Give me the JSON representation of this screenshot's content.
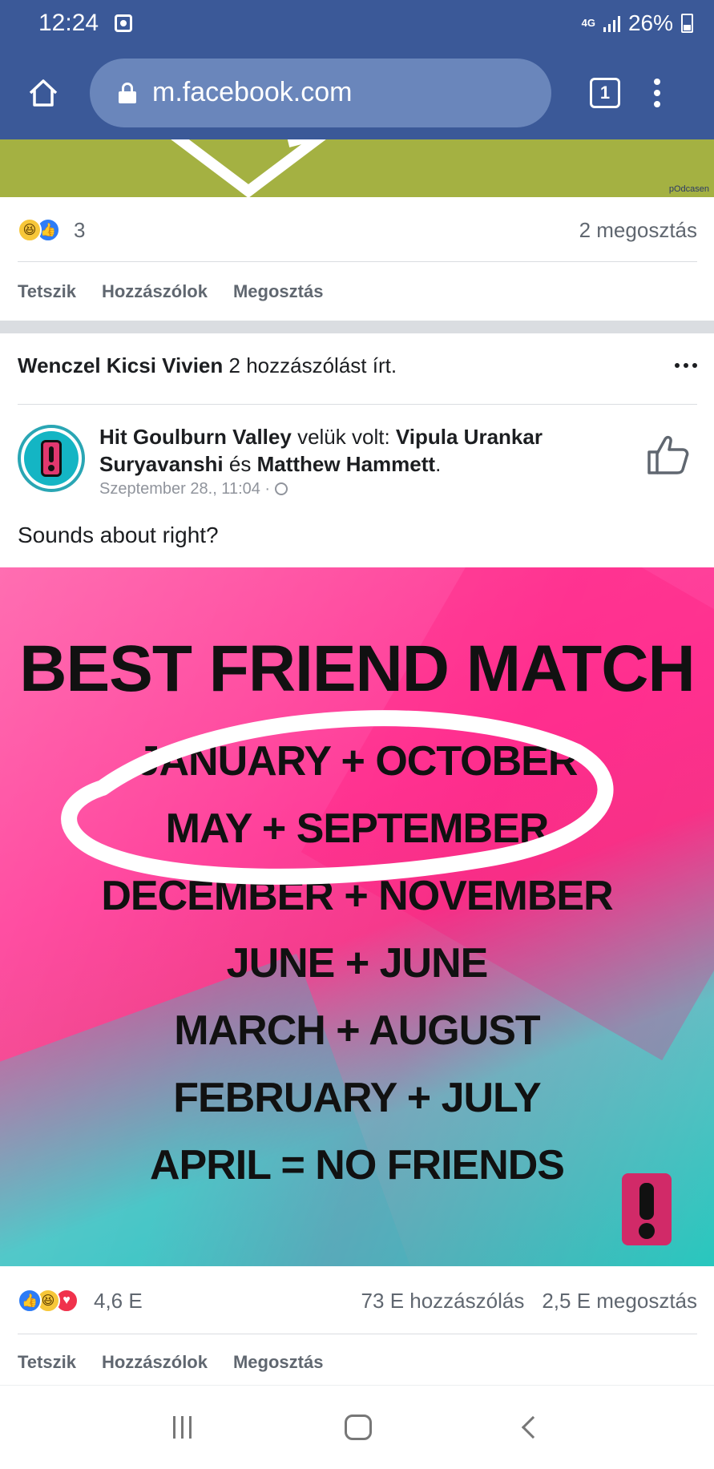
{
  "status_bar": {
    "time": "12:24",
    "network": "4G",
    "battery": "26%"
  },
  "browser": {
    "url": "m.facebook.com",
    "tab_count": "1"
  },
  "previous_post": {
    "watermark": "pOdcasen",
    "reaction_count": "3",
    "shares": "2 megosztás",
    "actions": [
      "Tetszik",
      "Hozzászólok",
      "Megosztás"
    ]
  },
  "activity": {
    "user": "Wenczel Kicsi Vivien",
    "text": "2 hozzászólást írt."
  },
  "post": {
    "page_name": "Hit Goulburn Valley",
    "with_text": "velük volt:",
    "person1": "Vipula Urankar Suryavanshi",
    "and_text": "és",
    "person2": "Matthew Hammett",
    "period": ".",
    "timestamp": "Szeptember 28., 11:04 ·",
    "caption": "Sounds about right?",
    "image": {
      "title": "BEST FRIEND MATCH",
      "lines": [
        "JANUARY + OCTOBER",
        "MAY + SEPTEMBER",
        "DECEMBER + NOVEMBER",
        "JUNE + JUNE",
        "MARCH + AUGUST",
        "FEBRUARY + JULY",
        "APRIL = NO FRIENDS"
      ]
    },
    "reaction_count": "4,6 E",
    "comments": "73 E hozzászólás",
    "shares": "2,5 E megosztás",
    "actions": [
      "Tetszik",
      "Hozzászólok",
      "Megosztás"
    ]
  },
  "icons": {
    "home": "home-icon",
    "lock": "lock-icon",
    "tabs": "tabs-icon",
    "menu": "more-vertical-icon",
    "like_reaction": "like-reaction-icon",
    "haha_reaction": "haha-reaction-icon",
    "love_reaction": "love-reaction-icon",
    "thumb": "thumbs-up-icon",
    "globe": "globe-icon",
    "recent_apps": "recent-apps-icon",
    "nav_home": "nav-home-icon",
    "back": "back-icon"
  },
  "colors": {
    "facebook_blue": "#3b5998",
    "url_box": "#6a86bb",
    "secondary_text": "#606770",
    "image_pink": "#ff3f9a",
    "image_teal": "#28c7be"
  }
}
